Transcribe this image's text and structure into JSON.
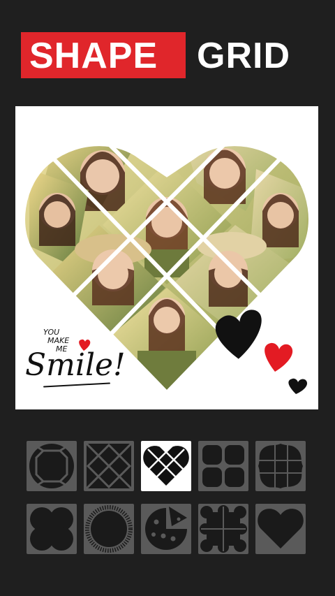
{
  "title": {
    "highlight": "SHAPE",
    "rest": "GRID"
  },
  "colors": {
    "accent": "#e0262b",
    "background": "#1f1f1f",
    "tile": "#5a5a5a",
    "tile_selected": "#ffffff"
  },
  "canvas": {
    "caption_small": [
      "YOU",
      "MAKE",
      "ME"
    ],
    "caption_script": "Smile!",
    "photo_count": 9
  },
  "shapes": [
    {
      "name": "circle-octagon-grid",
      "selected": false
    },
    {
      "name": "diamond-x-grid",
      "selected": false
    },
    {
      "name": "heart-grid",
      "selected": true
    },
    {
      "name": "rounded-square-grid",
      "selected": false
    },
    {
      "name": "wavy-blob-grid",
      "selected": false
    },
    {
      "name": "four-petal-flower",
      "selected": false
    },
    {
      "name": "fuzzy-circle",
      "selected": false
    },
    {
      "name": "cookie-circle",
      "selected": false
    },
    {
      "name": "scalloped-square",
      "selected": false
    },
    {
      "name": "heart",
      "selected": false
    }
  ]
}
